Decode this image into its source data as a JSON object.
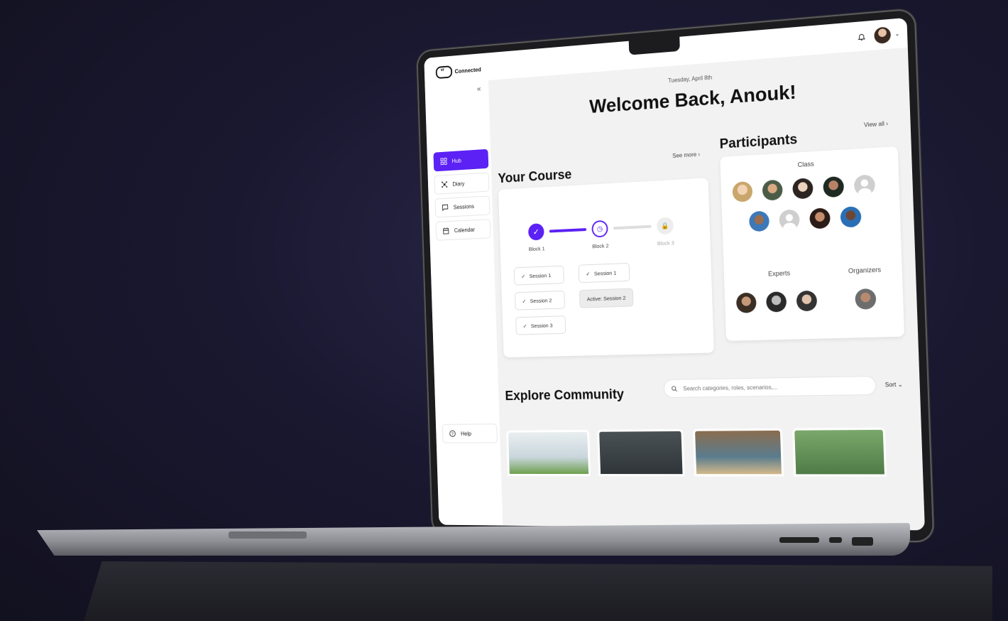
{
  "app": {
    "logo_text": "Connected",
    "logo_mark_text": "vr"
  },
  "sidebar": {
    "items": [
      {
        "label": "Hub",
        "icon": "grid-icon",
        "active": true
      },
      {
        "label": "Diary",
        "icon": "network-icon",
        "active": false
      },
      {
        "label": "Sessions",
        "icon": "chat-icon",
        "active": false
      },
      {
        "label": "Calendar",
        "icon": "calendar-icon",
        "active": false
      }
    ],
    "help_label": "Help"
  },
  "header": {
    "date": "Tuesday, April 8th",
    "welcome": "Welcome Back, Anouk!"
  },
  "course": {
    "title": "Your Course",
    "see_more": "See more",
    "blocks": [
      {
        "label": "Block 1",
        "state": "done"
      },
      {
        "label": "Block 2",
        "state": "current"
      },
      {
        "label": "Block 3",
        "state": "locked"
      }
    ],
    "block1_sessions": [
      "Session 1",
      "Session 2",
      "Session 3"
    ],
    "block2_sessions": [
      "Session 1",
      "Active: Session 2"
    ]
  },
  "participants": {
    "title": "Participants",
    "view_all": "View all",
    "class_label": "Class",
    "experts_label": "Experts",
    "organizers_label": "Organizers"
  },
  "community": {
    "title": "Explore Community",
    "search_placeholder": "Search categories, roles, scenarios,...",
    "sort_label": "Sort"
  },
  "colors": {
    "accent": "#5b21f5",
    "background": "#f2f2f2"
  }
}
